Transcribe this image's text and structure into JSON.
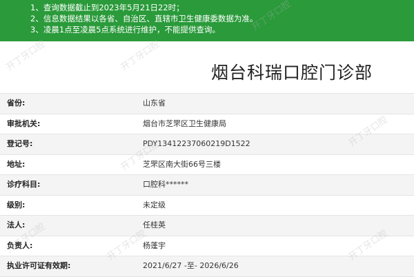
{
  "notices": [
    "1、查询数据截止到2023年5月21日22时；",
    "2、信息数据结果以各省、自治区、直辖市卫生健康委数据为准。",
    "3、凌晨1点至凌晨5点系统进行维护，不能提供查询。"
  ],
  "heading": "烟台科瑞口腔门诊部",
  "rows": [
    {
      "label": "省份:",
      "value": "山东省"
    },
    {
      "label": "审批机关:",
      "value": "烟台市芝罘区卫生健康局"
    },
    {
      "label": "登记号:",
      "value": "PDY13412237060219D1522"
    },
    {
      "label": "地址:",
      "value": "芝罘区南大街66号三楼"
    },
    {
      "label": "诊疗科目:",
      "value": "口腔科******"
    },
    {
      "label": "级别:",
      "value": "未定级"
    },
    {
      "label": "法人:",
      "value": "任桂英"
    },
    {
      "label": "负责人:",
      "value": "杨蓬宇"
    },
    {
      "label": "执业许可证有效期:",
      "value": "2021/6/27 -至- 2026/6/26"
    }
  ],
  "watermark": "开丁牙口腔",
  "colors": {
    "banner": "#2a9a3a"
  }
}
